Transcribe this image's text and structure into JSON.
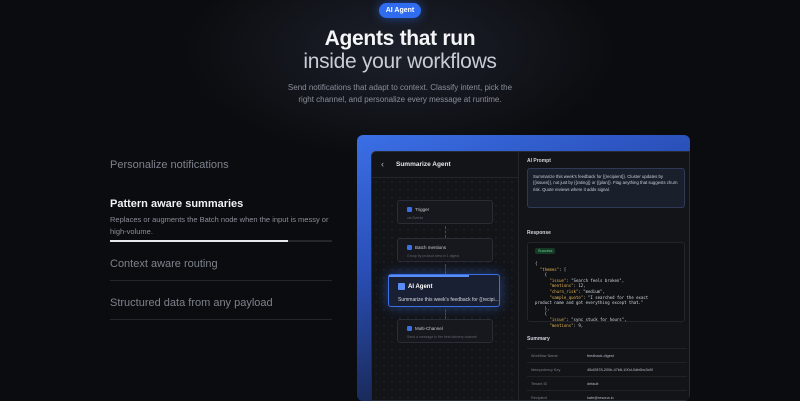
{
  "badge": "AI Agent",
  "headline": {
    "line1": "Agents that run",
    "line2": "inside your workflows"
  },
  "subtitle": {
    "line1": "Send notifications that adapt to context. Classify intent, pick the",
    "line2": "right channel, and personalize every message at runtime."
  },
  "features": [
    {
      "title": "Personalize notifications",
      "description": "",
      "active": false
    },
    {
      "title": "Pattern aware summaries",
      "description": "Replaces or augments the Batch node when the input is messy or high-volume.",
      "active": true,
      "progress": 0.8
    },
    {
      "title": "Context aware routing",
      "description": "",
      "active": false
    },
    {
      "title": "Structured data from any payload",
      "description": "",
      "active": false
    }
  ],
  "panel": {
    "back_icon": "chevron-left-icon",
    "title": "Summarize Agent",
    "nodes": {
      "trigger": {
        "title": "Trigger",
        "description": "via Events"
      },
      "batch": {
        "title": "Batch mentions",
        "description": "Group by product area in 1 digest"
      },
      "agent": {
        "title": "AI Agent",
        "description": "Summarize this week's feedback for {{recipi..."
      },
      "multi": {
        "title": "Multi-Channel",
        "description": "Send a message to the best delivery channel"
      }
    },
    "ai_prompt": {
      "heading": "AI Prompt",
      "text": "Summarize this week's feedback for {{recipient}}. Cluster updates by {{issues}}, not just by {{rating}} or {{plan}}. Flag anything that suggests churn risk. Quote reviews where it adds signal."
    },
    "response": {
      "heading": "Response",
      "status": "Success",
      "json_lines": [
        "{",
        "  \"themes\": [",
        "    {",
        "      \"issue\": \"Search feels broken\",",
        "      \"mentions\": 12,",
        "      \"churn_risk\": \"medium\",",
        "      \"sample_quote\": \"I searched for the exact",
        "product name and got everything except that.\"",
        "    },",
        "    {",
        "      \"issue\": \"sync stuck for hours\",",
        "      \"mentions\": 9,"
      ]
    },
    "summary": {
      "heading": "Summary",
      "rows": [
        {
          "label": "Workflow Name",
          "value": "feedback-digest"
        },
        {
          "label": "Idempotency Key",
          "value": "45cf2878-200b-47b8-100d-0db6bc3c5f"
        },
        {
          "label": "Tenant ID",
          "value": "default"
        },
        {
          "label": "Recipient",
          "value": "kate@resona.io"
        }
      ]
    }
  }
}
